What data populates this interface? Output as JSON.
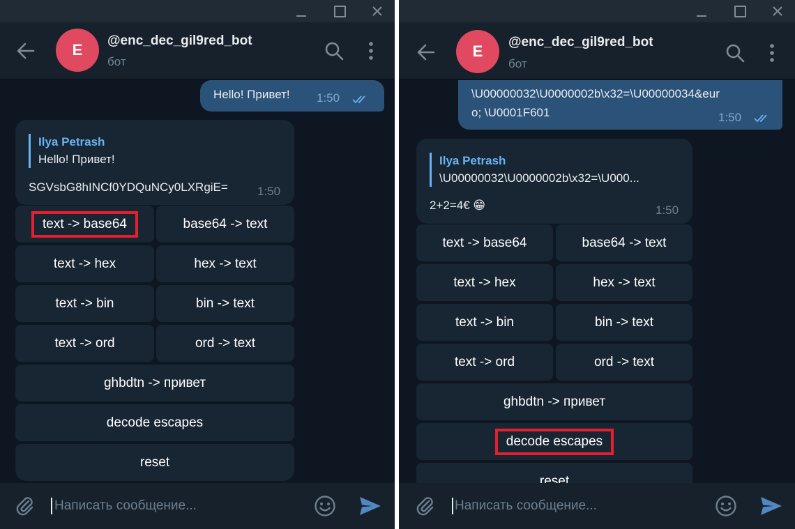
{
  "colors": {
    "background": "#0e1621",
    "header": "#17212b",
    "outgoing_bubble": "#2b5278",
    "incoming_bubble": "#182533",
    "accent": "#6ab3f3",
    "avatar": "#e0495f",
    "highlight": "#e5202e"
  },
  "chat": {
    "bot_name": "@enc_dec_gil9red_bot",
    "status": "бот",
    "avatar_letter": "E",
    "input_placeholder": "Написать сообщение..."
  },
  "left": {
    "outgoing": {
      "text": "Hello! Привет!",
      "time": "1:50"
    },
    "reply": {
      "quote_author": "Ilya Petrash",
      "quote_text": "Hello! Привет!",
      "text": "SGVsbG8hINCf0YDQuNCy0LXRgiE=",
      "time": "1:50"
    },
    "highlighted_button": "text -> base64"
  },
  "right": {
    "outgoing": {
      "line1": "\\U00000032\\U0000002b\\x32=\\U00000034&eur",
      "line2": "o; \\U0001F601",
      "time": "1:50"
    },
    "reply": {
      "quote_author": "Ilya Petrash",
      "quote_text": "\\U00000032\\U0000002b\\x32=\\U000...",
      "text": "2+2=4€ 😁",
      "time": "1:50"
    },
    "highlighted_button": "decode escapes"
  },
  "keyboard": {
    "text_to_base64": "text -> base64",
    "base64_to_text": "base64 -> text",
    "text_to_hex": "text -> hex",
    "hex_to_text": "hex -> text",
    "text_to_bin": "text -> bin",
    "bin_to_text": "bin -> text",
    "text_to_ord": "text -> ord",
    "ord_to_text": "ord -> text",
    "layout_fix": "ghbdtn -> привет",
    "decode_escapes": "decode escapes",
    "reset": "reset"
  },
  "icons": {
    "back": "arrow-left-icon",
    "search": "search-icon",
    "menu": "more-vertical-icon",
    "attach": "paperclip-icon",
    "emoji": "smile-icon",
    "send": "send-icon",
    "read": "double-check-icon"
  }
}
